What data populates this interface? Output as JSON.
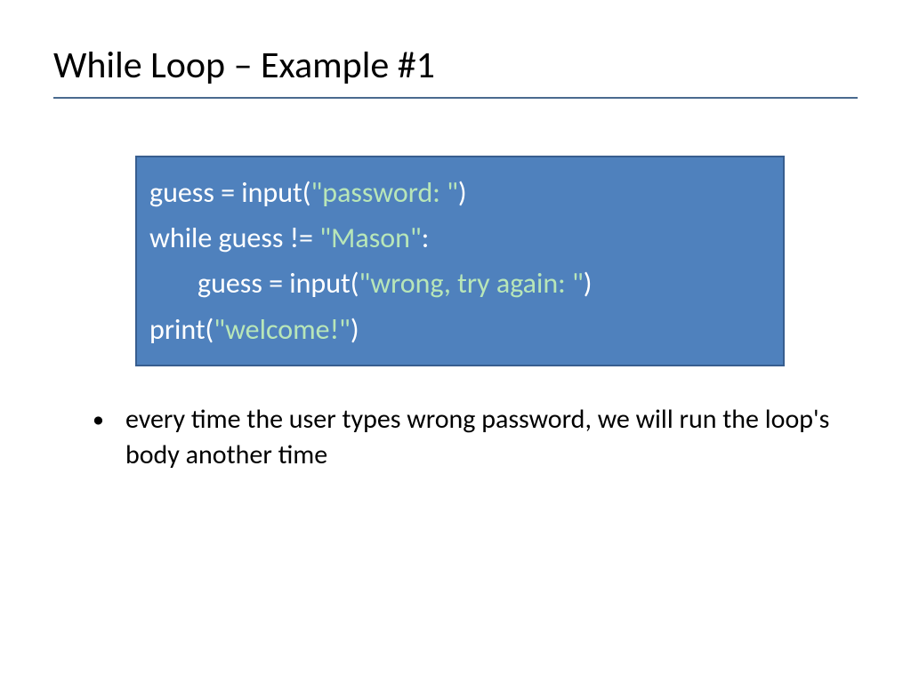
{
  "title": "While Loop – Example #1",
  "code": {
    "line1": {
      "part1": "guess = input(",
      "string": "\"password: \"",
      "part2": ")"
    },
    "line2": {
      "part1": "while guess != ",
      "string": "\"Mason\"",
      "part2": ":"
    },
    "line3": {
      "part1": "guess = input(",
      "string": "\"wrong, try again: \"",
      "part2": ")"
    },
    "line4": {
      "part1": "print(",
      "string": "\"welcome!\"",
      "part2": ")"
    }
  },
  "bullet": "every time the user types wrong password, we will run the loop's body another time"
}
